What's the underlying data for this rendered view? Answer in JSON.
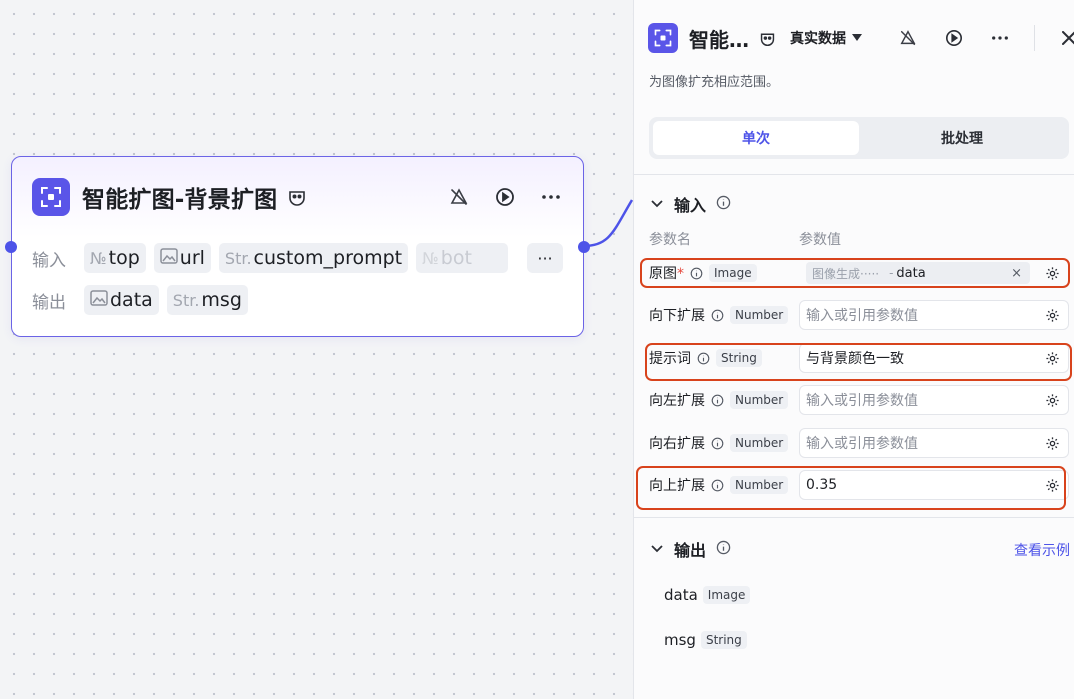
{
  "node": {
    "title": "智能扩图-背景扩图",
    "title_badge_icon": "mask-icon",
    "actions": [
      "debug-off-icon",
      "run-icon",
      "more-icon"
    ],
    "input_label": "输入",
    "output_label": "输出",
    "inputs": [
      {
        "prefix": "№",
        "name": "top"
      },
      {
        "prefix": "img",
        "name": "url"
      },
      {
        "prefix": "Str.",
        "name": "custom_prompt"
      },
      {
        "prefix": "№",
        "name": "bot",
        "faded": true
      }
    ],
    "more_label": "···",
    "outputs": [
      {
        "prefix": "img",
        "name": "data"
      },
      {
        "prefix": "Str.",
        "name": "msg"
      }
    ],
    "accent_color": "#4d53e8"
  },
  "panel": {
    "title": "智能…",
    "data_mode": "真实数据",
    "description": "为图像扩充相应范围。",
    "tabs": [
      {
        "label": "单次",
        "active": true
      },
      {
        "label": "批处理",
        "active": false
      }
    ],
    "input_section": {
      "label": "输入",
      "col_name": "参数名",
      "col_value": "参数值",
      "params": [
        {
          "name": "原图",
          "required": true,
          "type": "Image",
          "ref_source": "图像生成·····",
          "ref_value": "data",
          "highlight": true
        },
        {
          "name": "向下扩展",
          "type": "Number",
          "placeholder": "输入或引用参数值"
        },
        {
          "name": "提示词",
          "type": "String",
          "value": "与背景颜色一致",
          "highlight": true
        },
        {
          "name": "向左扩展",
          "type": "Number",
          "placeholder": "输入或引用参数值"
        },
        {
          "name": "向右扩展",
          "type": "Number",
          "placeholder": "输入或引用参数值"
        },
        {
          "name": "向上扩展",
          "type": "Number",
          "value": "0.35",
          "highlight": true
        }
      ]
    },
    "output_section": {
      "label": "输出",
      "view_example": "查看示例",
      "outputs": [
        {
          "name": "data",
          "type": "Image"
        },
        {
          "name": "msg",
          "type": "String"
        }
      ]
    },
    "highlight_color": "#d8431c"
  }
}
